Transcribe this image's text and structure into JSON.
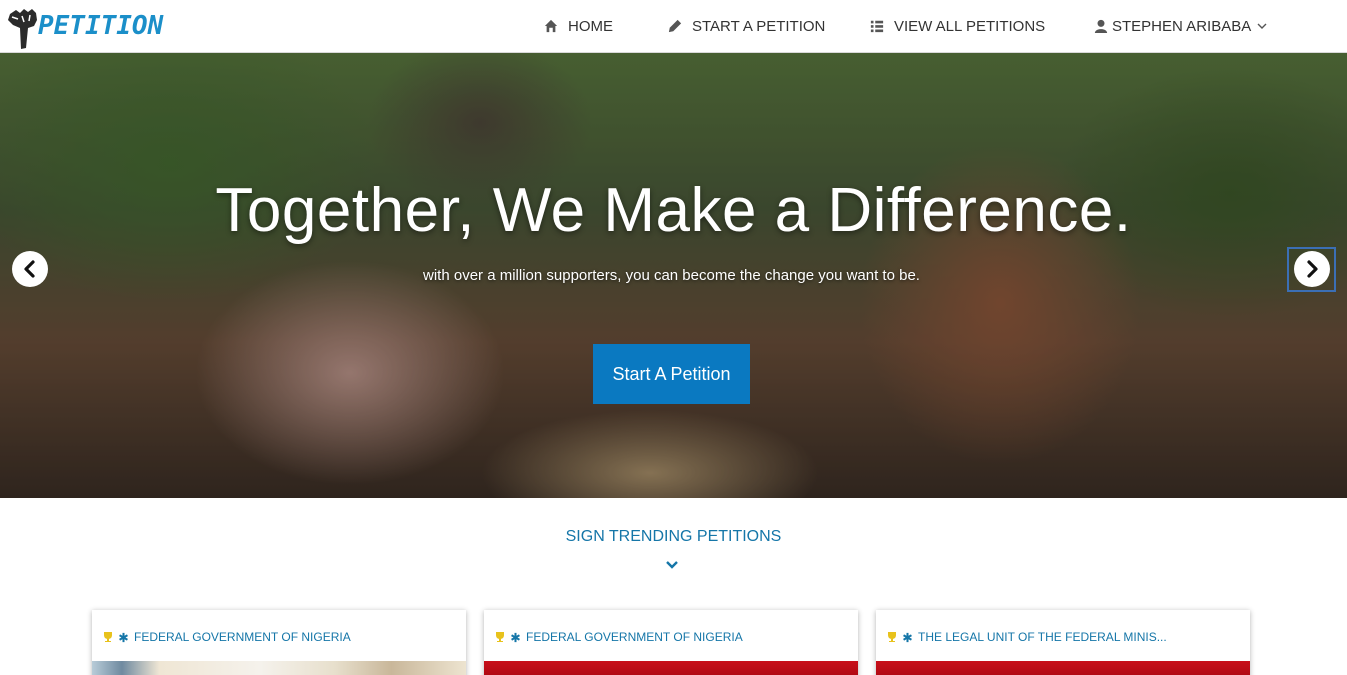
{
  "brand": {
    "name": "PETITION"
  },
  "nav": {
    "home": "HOME",
    "start": "START A PETITION",
    "view_all": "VIEW ALL PETITIONS",
    "user": "STEPHEN ARIBABA"
  },
  "hero": {
    "title": "Together, We Make a Difference.",
    "subtitle": "with over a million supporters, you can become the change you want to be.",
    "cta": "Start A Petition"
  },
  "trending": {
    "heading": "SIGN TRENDING PETITIONS",
    "cards": [
      {
        "target": "FEDERAL GOVERNMENT OF NIGERIA"
      },
      {
        "target": "FEDERAL GOVERNMENT OF NIGERIA"
      },
      {
        "target": "THE LEGAL UNIT OF THE FEDERAL MINIS..."
      }
    ]
  },
  "icons": {
    "home": "home-icon",
    "start": "pencil-icon",
    "view_all": "list-icon",
    "user": "user-icon",
    "caret": "chevron-down-icon",
    "prev": "chevron-left-icon",
    "next": "chevron-right-icon",
    "trophy": "trophy-icon",
    "star": "asterisk-icon"
  },
  "colors": {
    "brand": "#1b8fc9",
    "accent": "#1576a8",
    "cta": "#0a79c1",
    "trophy": "#e8c21c"
  }
}
